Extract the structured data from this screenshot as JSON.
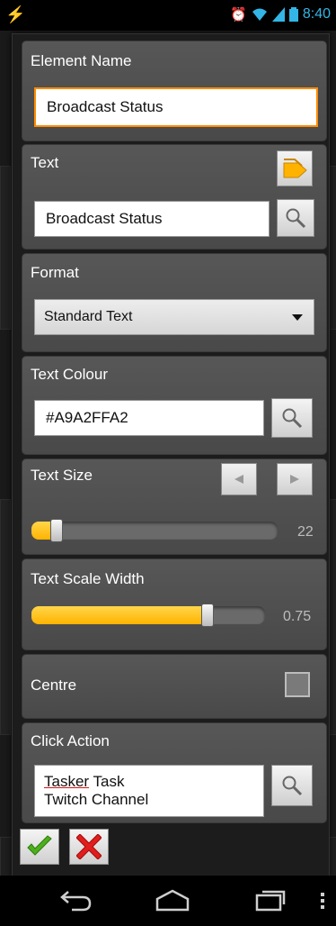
{
  "status_bar": {
    "time": "8:40"
  },
  "dialog": {
    "element_name": {
      "title": "Element Name",
      "value": "Broadcast Status"
    },
    "text": {
      "title": "Text",
      "value": "Broadcast Status"
    },
    "format": {
      "title": "Format",
      "selected": "Standard Text"
    },
    "text_colour": {
      "title": "Text Colour",
      "value": "#A9A2FFA2"
    },
    "text_size": {
      "title": "Text Size",
      "value": "22",
      "level": 0.1
    },
    "text_scale_width": {
      "title": "Text Scale Width",
      "value": "0.75",
      "level": 0.75
    },
    "centre": {
      "title": "Centre",
      "checked": false
    },
    "click_action": {
      "title": "Click Action",
      "line1_underlined": "Tasker",
      "line1_rest": " Task",
      "line2": "Twitch Channel"
    }
  },
  "colors": {
    "accent": "#ffb300",
    "focus_border": "#ff8c00",
    "status_blue": "#33b5e5"
  }
}
